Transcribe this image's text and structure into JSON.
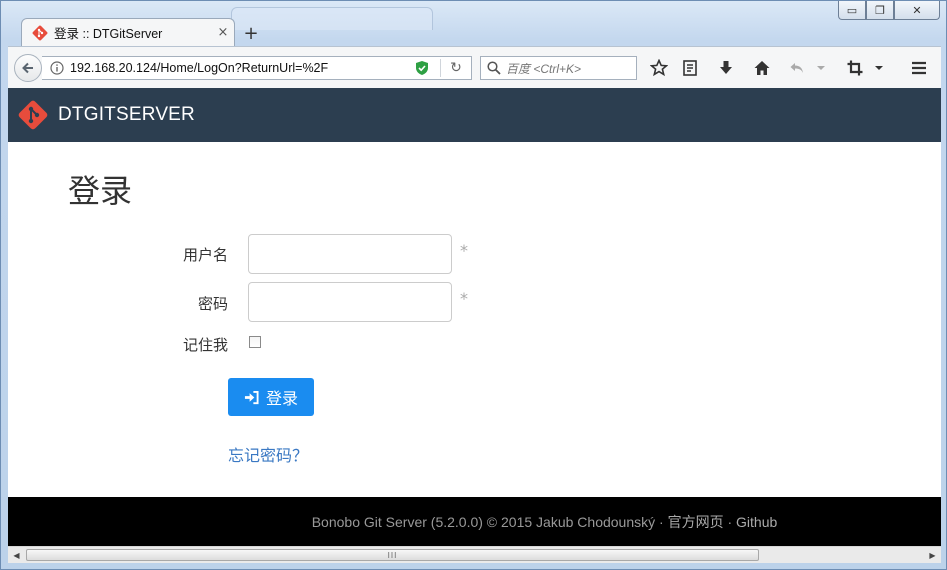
{
  "browser": {
    "tab": {
      "title": "登录 :: DTGitServer",
      "close": "×"
    },
    "new_tab": "+",
    "window_controls": {
      "minimize": "▭",
      "maximize": "❐",
      "close": "✕"
    },
    "url": "192.168.20.124/Home/LogOn?ReturnUrl=%2F",
    "search_placeholder": "百度 <Ctrl+K>"
  },
  "page": {
    "brand": "DTGITSERVER",
    "title": "登录",
    "form": {
      "username_label": "用户名",
      "username_value": "",
      "password_label": "密码",
      "password_value": "",
      "remember_label": "记住我",
      "remember_checked": false,
      "required_mark": "*",
      "submit_label": "登录",
      "forgot_link": "忘记密码？"
    },
    "footer": {
      "text": "Bonobo Git Server (5.2.0.0) © 2015 Jakub Chodounský · ",
      "link1": "官方网页",
      "sep": " · ",
      "link2": "Github"
    }
  },
  "colors": {
    "navbar": "#2c3e50",
    "brand_accent": "#e74c3c",
    "primary_button": "#1a8cf0",
    "link": "#3a78c3"
  }
}
